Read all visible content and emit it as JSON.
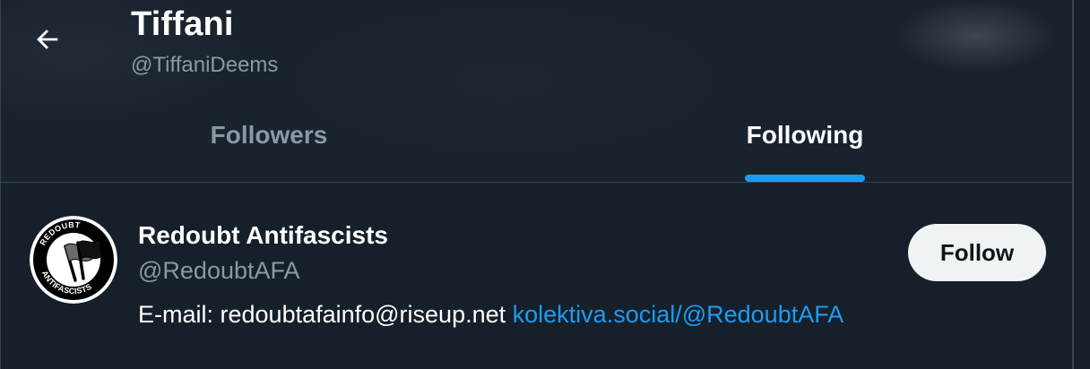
{
  "header": {
    "title": "Tiffani",
    "handle": "@TiffaniDeems"
  },
  "tabs": [
    {
      "label": "Followers",
      "active": false
    },
    {
      "label": "Following",
      "active": true
    }
  ],
  "user": {
    "name": "Redoubt Antifascists",
    "handle": "@RedoubtAFA",
    "bio_text": "E-mail: redoubtafainfo@riseup.net ",
    "bio_link": "kolektiva.social/@RedoubtAFA",
    "follow_label": "Follow",
    "avatar_text_top": "REDOUBT",
    "avatar_text_bottom": "ANTIFASCISTS"
  },
  "colors": {
    "background": "#15202b",
    "accent": "#1d9bf0",
    "secondary_text": "#8b98a5",
    "border": "#38444d",
    "button_bg": "#eff3f4"
  },
  "icons": {
    "back": "arrow-left-icon"
  }
}
